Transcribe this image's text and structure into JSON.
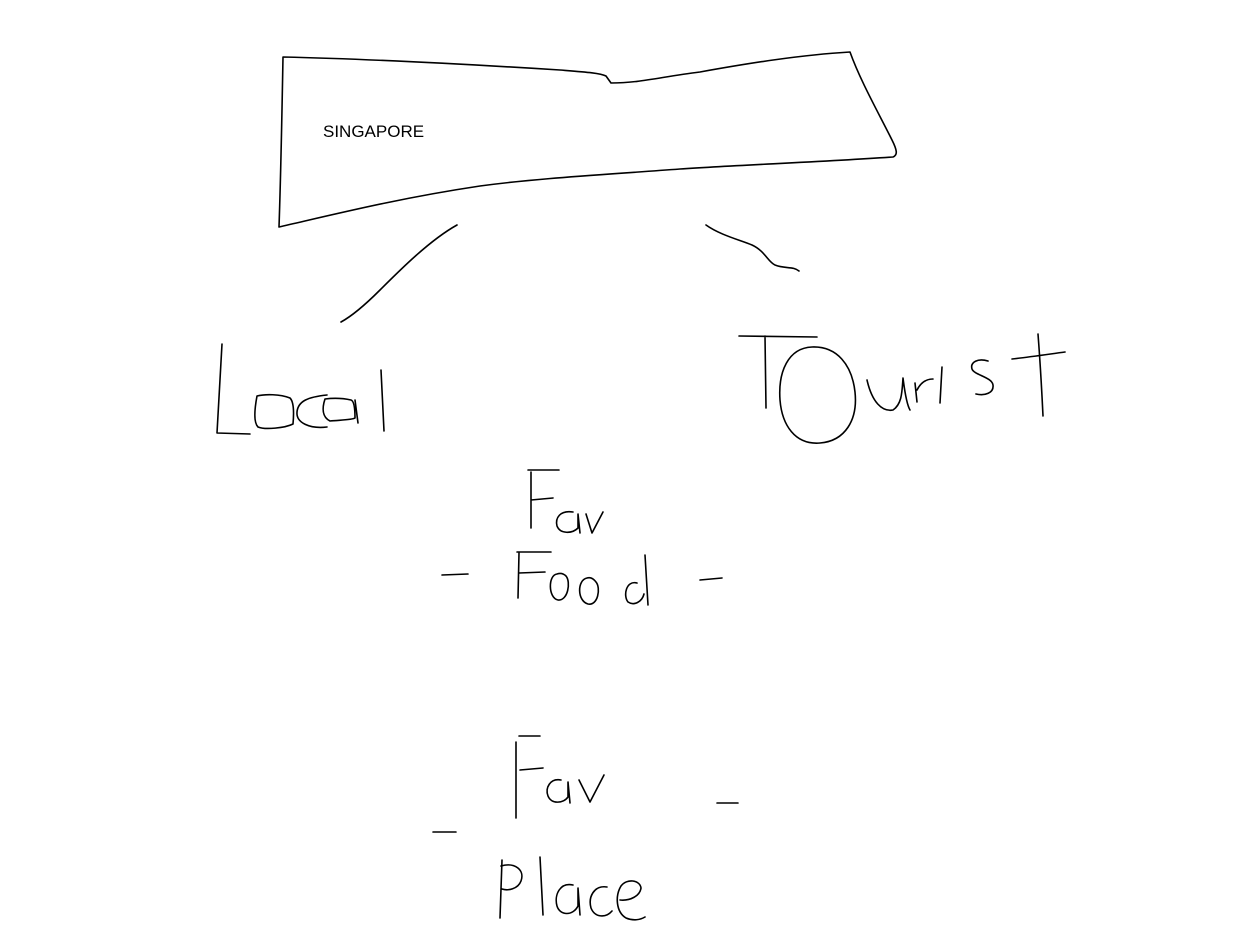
{
  "diagram": {
    "root": {
      "label": "SINGAPORE"
    },
    "branches": [
      {
        "label": "Local"
      },
      {
        "label": "Tourist"
      }
    ],
    "details": [
      {
        "line1": "Fav",
        "line2": "Food"
      },
      {
        "line1": "Fav",
        "line2": "Place"
      }
    ],
    "stroke_color": "#000000",
    "background_color": "#ffffff"
  }
}
